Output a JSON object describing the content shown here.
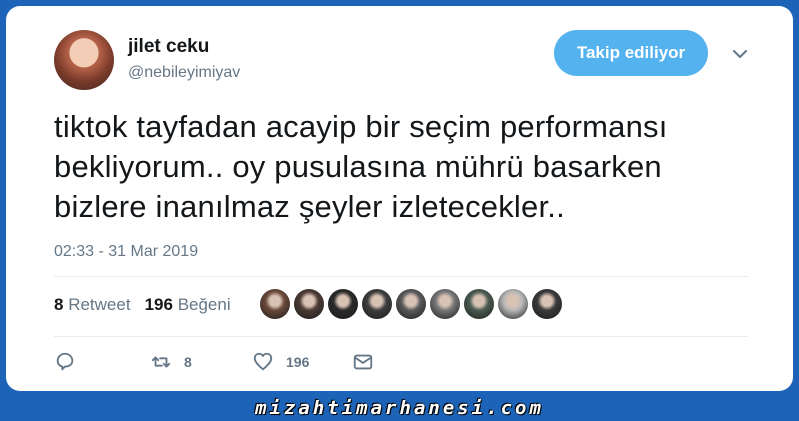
{
  "user": {
    "display_name": "jilet ceku",
    "handle": "@nebileyimiyav"
  },
  "follow_button": {
    "label": "Takip ediliyor"
  },
  "tweet": {
    "lines": [
      "tiktok tayfadan acayip bir seçim performansı",
      "bekliyorum.. oy pusulasına mührü basarken",
      "bizlere inanılmaz şeyler izletecekler.."
    ],
    "timestamp": "02:33 - 31 Mar 2019"
  },
  "stats": {
    "retweet_count": "8",
    "retweet_label": "Retweet",
    "like_count": "196",
    "like_label": "Beğeni"
  },
  "likers": [
    {
      "color": "#6b4a3a"
    },
    {
      "color": "#4d3b35"
    },
    {
      "color": "#2b2b2b"
    },
    {
      "color": "#3e3e3e"
    },
    {
      "color": "#5a5a5a"
    },
    {
      "color": "#777777"
    },
    {
      "color": "#4c5c52"
    },
    {
      "color": "#b8b8b8"
    },
    {
      "color": "#3a3a3a"
    }
  ],
  "actions": {
    "reply_count": "",
    "retweet_count": "8",
    "like_count": "196"
  },
  "watermark": "mizahtimarhanesi.com",
  "colors": {
    "background": "#1d64b8",
    "accent": "#54b2ef",
    "text": "#14171a",
    "muted": "#657786"
  }
}
